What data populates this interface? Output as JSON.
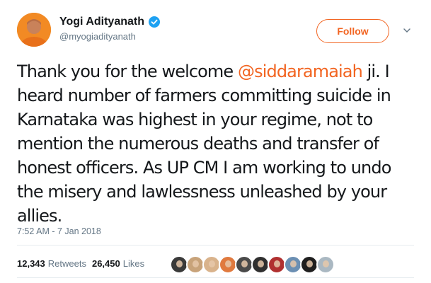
{
  "user": {
    "display_name": "Yogi Adityanath",
    "handle": "@myogiadityanath",
    "verified": true,
    "avatar_icon": "profile-photo"
  },
  "actions": {
    "follow_label": "Follow",
    "more_icon": "chevron-down-icon"
  },
  "tweet": {
    "text_before": "Thank you for the welcome ",
    "mention": "@siddaramaiah",
    "text_after": " ji. I heard number of farmers committing suicide in Karnataka was highest in your regime, not to mention the numerous deaths and transfer of honest officers. As UP CM I am working to undo the misery and lawlessness unleashed by your allies.",
    "timestamp": "7:52 AM - 7 Jan 2018"
  },
  "stats": {
    "retweets_count": "12,343",
    "retweets_label": "Retweets",
    "likes_count": "26,450",
    "likes_label": "Likes"
  },
  "liker_avatars": [
    {
      "name": "liker-avatar-1",
      "color": "#3a3a3a"
    },
    {
      "name": "liker-avatar-2",
      "color": "#c8a37a"
    },
    {
      "name": "liker-avatar-3",
      "color": "#d9b38c"
    },
    {
      "name": "liker-avatar-4",
      "color": "#e07a3f"
    },
    {
      "name": "liker-avatar-5",
      "color": "#4a4a4a"
    },
    {
      "name": "liker-avatar-6",
      "color": "#2f2f2f"
    },
    {
      "name": "liker-avatar-7",
      "color": "#b03030"
    },
    {
      "name": "liker-avatar-8",
      "color": "#6b8fb3"
    },
    {
      "name": "liker-avatar-9",
      "color": "#1f1f1f"
    },
    {
      "name": "liker-avatar-10",
      "color": "#aab8c2"
    }
  ],
  "colors": {
    "accent": "#f26522",
    "muted": "#657786",
    "verified_blue": "#1da1f2"
  }
}
